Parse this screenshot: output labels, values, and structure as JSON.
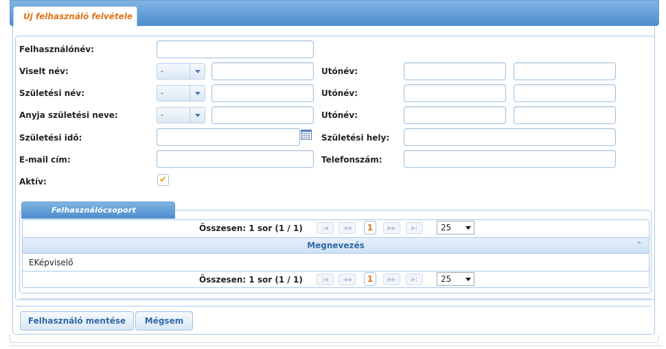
{
  "tab": {
    "title": "Új felhasználó felvétele"
  },
  "form": {
    "username_label": "Felhasználónév:",
    "used_name_label": "Viselt név:",
    "birth_name_label": "Születési név:",
    "mother_name_label": "Anyja születési neve:",
    "first_name_label": "Utónév:",
    "birth_date_label": "Születési idő:",
    "birth_place_label": "Születési hely:",
    "email_label": "E-mail cím:",
    "phone_label": "Telefonszám:",
    "active_label": "Aktív:",
    "title_select_value": "-",
    "active_checked": true
  },
  "group": {
    "title": "Felhasználócsoport",
    "pager_text": "Összesen: 1 sor (1 / 1)",
    "current_page": "1",
    "page_size": "25",
    "column_header": "Megnevezés",
    "rows": [
      {
        "name": "EKépviselő"
      }
    ]
  },
  "buttons": {
    "save": "Felhasználó mentése",
    "cancel": "Mégsem"
  },
  "colors": {
    "accent": "#4e8dcc",
    "tab_title": "#e0731a",
    "check": "#e8a317"
  }
}
